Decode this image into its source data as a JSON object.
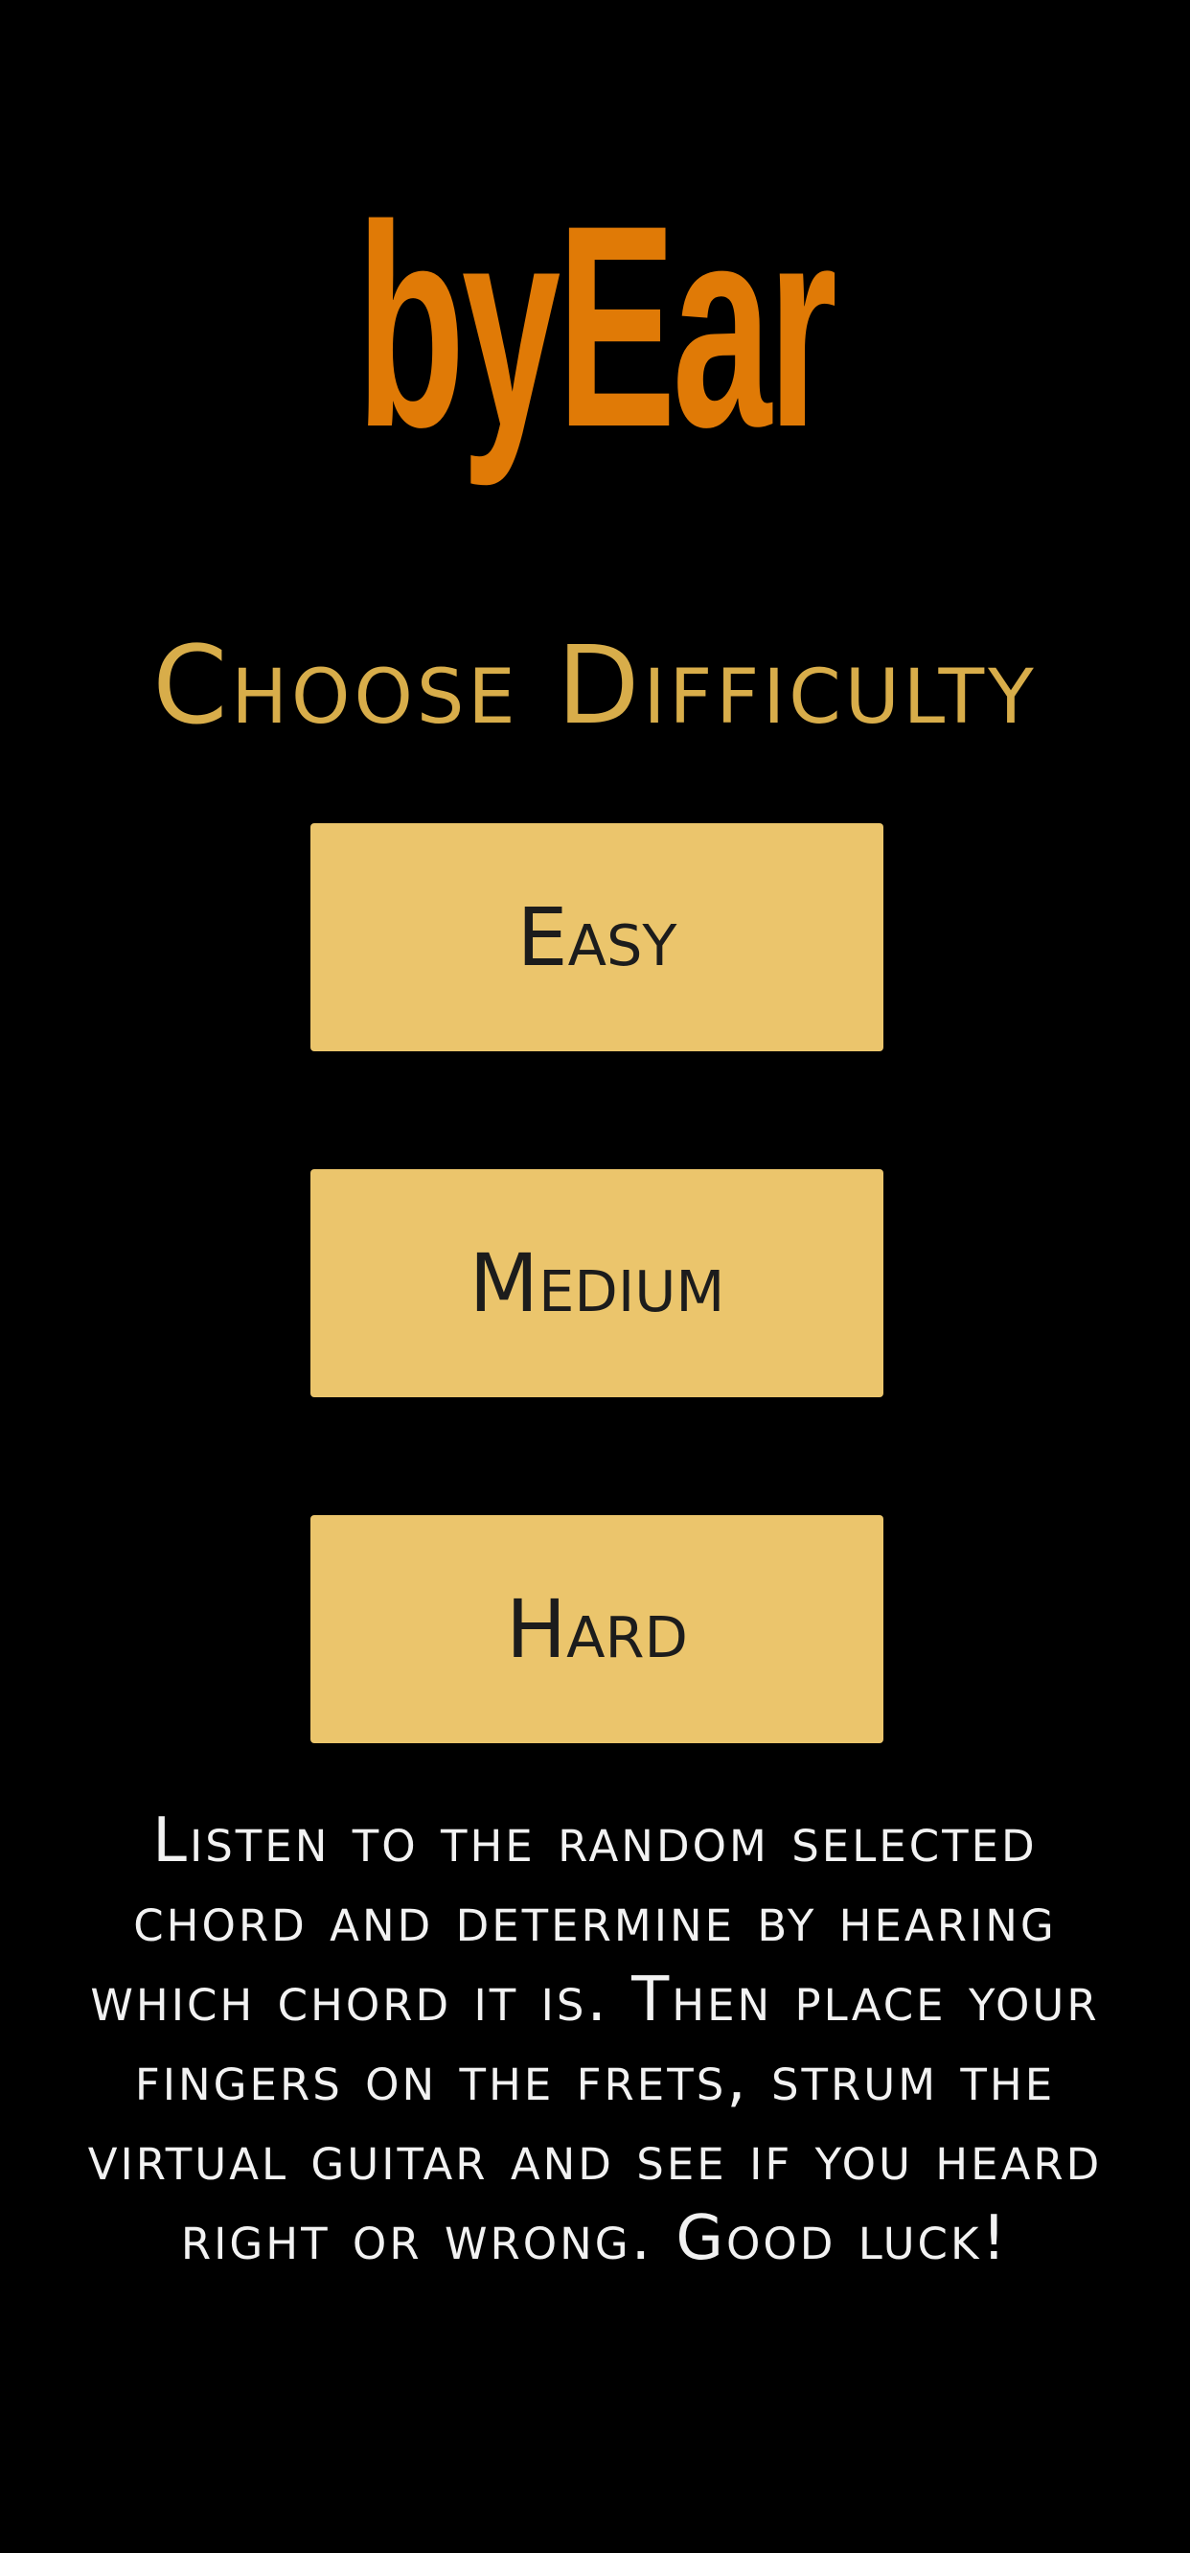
{
  "app": {
    "logo_text": "byEar"
  },
  "screen": {
    "title": "Choose Difficulty",
    "buttons": [
      {
        "label": "Easy"
      },
      {
        "label": "Medium"
      },
      {
        "label": "Hard"
      }
    ],
    "instructions": "Listen to the random selected chord and determine by hearing which chord it is. Then place your fingers on the frets, strum the virtual guitar and see if you heard right or wrong. Good luck!"
  },
  "colors": {
    "background": "#000000",
    "logo": "#e07a06",
    "title": "#d8ad4a",
    "button_fill": "#ebc56c",
    "button_text": "#1c1c1c",
    "instructions_text": "#f2f2f2"
  }
}
